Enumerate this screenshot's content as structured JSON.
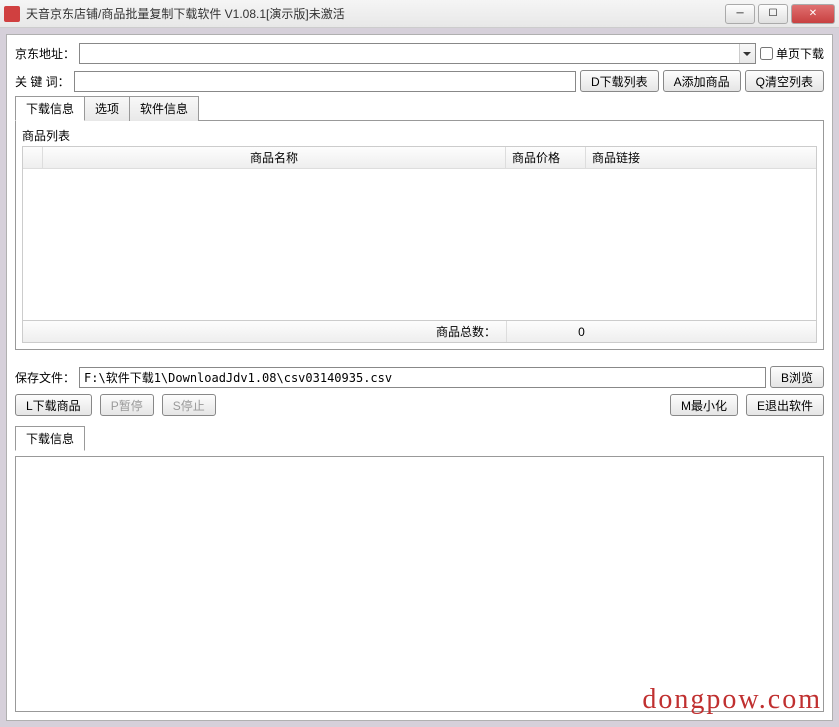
{
  "window": {
    "title": "天音京东店铺/商品批量复制下载软件 V1.08.1[演示版]未激活"
  },
  "form": {
    "address_label": "京东地址：",
    "address_value": "",
    "single_page_label": "单页下载",
    "keyword_label": "关 键 词：",
    "keyword_value": ""
  },
  "buttons": {
    "download_list": "D下载列表",
    "add_product": "A添加商品",
    "clear_list": "Q清空列表",
    "browse": "B浏览",
    "download_products": "L下载商品",
    "pause": "P暂停",
    "stop": "S停止",
    "minimize": "M最小化",
    "exit": "E退出软件"
  },
  "tabs": {
    "download_info": "下载信息",
    "options": "选项",
    "software_info": "软件信息"
  },
  "table": {
    "group_label": "商品列表",
    "col_name": "商品名称",
    "col_price": "商品价格",
    "col_link": "商品链接",
    "total_label": "商品总数：",
    "total_value": "0"
  },
  "save": {
    "label": "保存文件：",
    "path": "F:\\软件下载1\\DownloadJdv1.08\\csv03140935.csv"
  },
  "log": {
    "tab_label": "下载信息"
  },
  "watermark": "dongpow.com"
}
